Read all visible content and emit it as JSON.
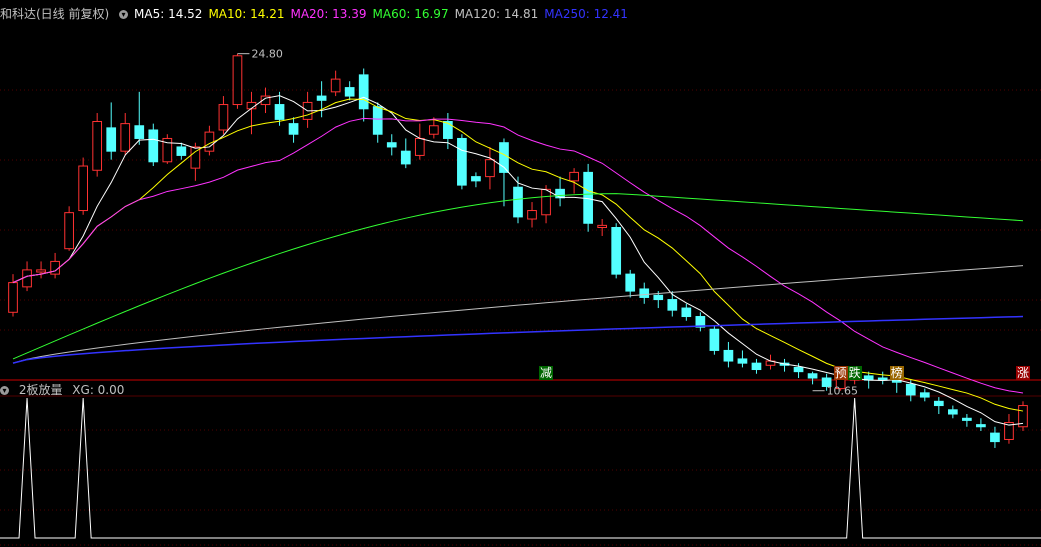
{
  "header": {
    "stock_title": "和科达(日线 前复权)",
    "ma_items": [
      {
        "label": "MA5: 14.52",
        "color": "#ffffff"
      },
      {
        "label": "MA10: 14.21",
        "color": "#ffff00"
      },
      {
        "label": "MA20: 13.39",
        "color": "#ff33ff"
      },
      {
        "label": "MA60: 16.97",
        "color": "#33ff33"
      },
      {
        "label": "MA120: 14.81",
        "color": "#c0c0c0"
      },
      {
        "label": "MA250: 12.41",
        "color": "#3333ff"
      }
    ]
  },
  "indicator": {
    "title": "2板放量",
    "xg_label": "XG: 0.00"
  },
  "annotations": {
    "high_price": "24.80",
    "low_price": "10.65"
  },
  "signals": [
    {
      "text": "减",
      "bg": "#006600",
      "fg": "#ffffff"
    },
    {
      "text": "预",
      "bg": "#993300",
      "fg": "#ffffff"
    },
    {
      "text": "跌",
      "bg": "#006600",
      "fg": "#ffffff"
    },
    {
      "text": "榜",
      "bg": "#996600",
      "fg": "#ffffff"
    },
    {
      "text": "涨",
      "bg": "#990000",
      "fg": "#ffffff"
    }
  ],
  "colors": {
    "up": "#ff3232",
    "down": "#54ffff",
    "grid": "#550000",
    "divider": "#cc0000"
  },
  "chart_data": {
    "type": "candlestick",
    "y_range": [
      9.5,
      26.2
    ],
    "candles": [
      [
        12.6,
        14.0,
        12.4,
        14.4
      ],
      [
        13.8,
        14.6,
        13.6,
        15.0
      ],
      [
        14.5,
        14.6,
        14.2,
        15.0
      ],
      [
        14.4,
        15.0,
        14.2,
        15.4
      ],
      [
        15.6,
        17.3,
        15.5,
        17.6
      ],
      [
        17.4,
        19.5,
        17.2,
        19.9
      ],
      [
        19.3,
        21.6,
        19.0,
        22.0
      ],
      [
        21.3,
        20.2,
        19.8,
        22.5
      ],
      [
        20.2,
        21.5,
        20.0,
        22.0
      ],
      [
        21.4,
        20.8,
        20.5,
        23.0
      ],
      [
        21.2,
        19.7,
        19.5,
        21.5
      ],
      [
        19.7,
        20.8,
        19.6,
        21.0
      ],
      [
        20.4,
        20.0,
        19.8,
        20.6
      ],
      [
        19.4,
        20.4,
        18.8,
        20.6
      ],
      [
        20.2,
        21.1,
        20.0,
        21.4
      ],
      [
        21.2,
        22.4,
        21.0,
        22.8
      ],
      [
        22.4,
        24.7,
        22.2,
        24.8
      ],
      [
        22.2,
        22.5,
        21.0,
        23.0
      ],
      [
        22.4,
        22.8,
        22.0,
        23.2
      ],
      [
        22.4,
        21.7,
        21.4,
        23.0
      ],
      [
        21.5,
        21.0,
        20.6,
        21.8
      ],
      [
        21.7,
        22.5,
        21.3,
        23.0
      ],
      [
        22.8,
        22.6,
        21.8,
        23.5
      ],
      [
        23.0,
        23.6,
        22.8,
        24.0
      ],
      [
        23.2,
        22.8,
        22.6,
        23.5
      ],
      [
        23.8,
        22.2,
        21.6,
        24.1
      ],
      [
        22.3,
        21.0,
        20.6,
        22.5
      ],
      [
        20.6,
        20.4,
        20.0,
        21.0
      ],
      [
        20.2,
        19.6,
        19.4,
        20.8
      ],
      [
        20.0,
        20.8,
        19.8,
        21.5
      ],
      [
        21.0,
        21.4,
        20.8,
        21.8
      ],
      [
        21.6,
        20.8,
        20.3,
        22.0
      ],
      [
        20.8,
        18.6,
        18.4,
        21.0
      ],
      [
        19.0,
        18.8,
        18.5,
        19.2
      ],
      [
        19.0,
        19.8,
        18.4,
        20.4
      ],
      [
        20.6,
        19.2,
        17.6,
        20.8
      ],
      [
        18.5,
        17.1,
        16.8,
        19.0
      ],
      [
        17.0,
        17.4,
        16.6,
        17.8
      ],
      [
        17.2,
        18.4,
        16.8,
        18.6
      ],
      [
        18.4,
        18.0,
        17.6,
        19.0
      ],
      [
        18.8,
        19.2,
        18.2,
        19.4
      ],
      [
        19.2,
        16.8,
        16.4,
        19.6
      ],
      [
        16.6,
        16.7,
        16.2,
        17.0
      ],
      [
        16.6,
        14.4,
        14.2,
        16.8
      ],
      [
        14.4,
        13.6,
        13.3,
        14.6
      ],
      [
        13.7,
        13.3,
        13.0,
        14.0
      ],
      [
        13.4,
        13.2,
        12.8,
        13.6
      ],
      [
        13.2,
        12.7,
        12.4,
        13.6
      ],
      [
        12.8,
        12.4,
        12.2,
        13.0
      ],
      [
        12.4,
        11.9,
        11.7,
        12.6
      ],
      [
        11.8,
        10.8,
        10.6,
        12.0
      ],
      [
        10.8,
        10.3,
        10.0,
        11.2
      ],
      [
        10.4,
        10.2,
        10.0,
        10.8
      ],
      [
        10.2,
        9.9,
        9.7,
        10.4
      ],
      [
        10.1,
        10.3,
        9.9,
        10.6
      ],
      [
        10.2,
        10.1,
        9.8,
        10.4
      ],
      [
        10.0,
        9.8,
        9.5,
        10.2
      ],
      [
        9.7,
        9.5,
        9.2,
        9.8
      ],
      [
        9.5,
        9.1,
        8.9,
        9.7
      ],
      [
        9.0,
        9.5,
        8.9,
        9.7
      ],
      [
        9.4,
        9.5,
        9.2,
        9.7
      ],
      [
        9.6,
        9.4,
        9.0,
        9.8
      ],
      [
        9.5,
        9.4,
        9.2,
        9.8
      ],
      [
        9.5,
        9.3,
        8.8,
        9.7
      ],
      [
        9.2,
        8.7,
        8.4,
        9.4
      ],
      [
        8.8,
        8.6,
        8.4,
        9.0
      ],
      [
        8.4,
        8.2,
        7.8,
        8.6
      ],
      [
        8.0,
        7.8,
        7.6,
        8.2
      ],
      [
        7.6,
        7.5,
        7.2,
        7.8
      ],
      [
        7.3,
        7.2,
        7.0,
        7.6
      ],
      [
        6.9,
        6.5,
        6.2,
        7.2
      ],
      [
        6.6,
        7.4,
        6.4,
        7.8
      ],
      [
        7.2,
        8.2,
        7.0,
        8.4
      ]
    ]
  }
}
